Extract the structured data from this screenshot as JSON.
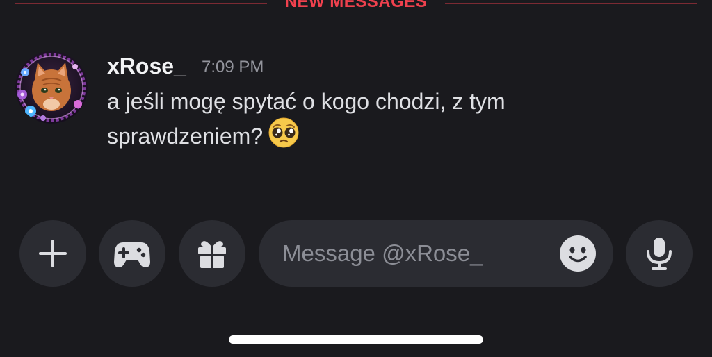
{
  "divider": {
    "label": "NEW MESSAGES",
    "color": "#f0414e"
  },
  "message": {
    "author": "xRose_",
    "timestamp": "7:09 PM",
    "text_line1": "a jeśli mogę spytać o kogo chodzi, z tym",
    "text_line2": "sprawdzeniem?",
    "emoji": "pleading-face-emoji",
    "avatar": "orange-cat-avatar-with-floral-frame"
  },
  "composer": {
    "placeholder": "Message @xRose_",
    "buttons": {
      "plus": "plus-icon",
      "games": "gamepad-icon",
      "gift": "gift-icon",
      "emoji": "emoji-icon",
      "mic": "microphone-icon"
    }
  },
  "colors": {
    "background": "#1a1a1e",
    "button_bg": "#2b2c32",
    "icon": "#dcdde1",
    "accent_red": "#f0414e"
  }
}
